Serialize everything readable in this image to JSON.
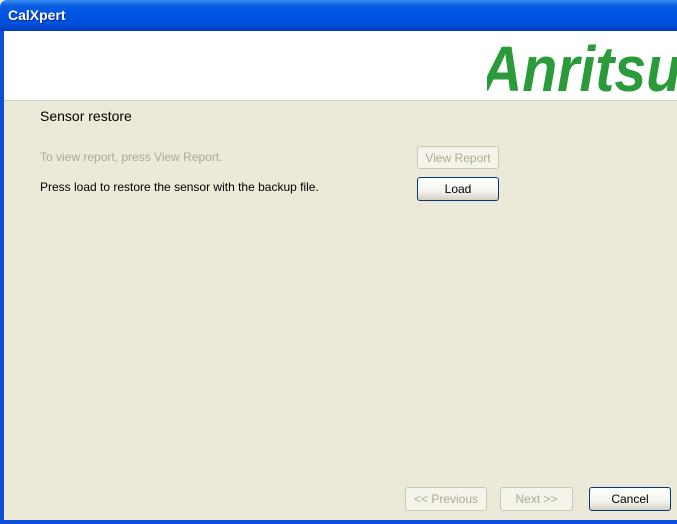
{
  "window": {
    "title": "CalXpert"
  },
  "banner": {
    "logo_text": "Anritsu",
    "brand_color": "#2b9a3a"
  },
  "page": {
    "heading": "Sensor restore",
    "report_instruction": "To view report, press View Report.",
    "load_instruction": "Press load to restore the sensor with the backup file."
  },
  "buttons": {
    "view_report": "View Report",
    "load": "Load",
    "previous": "<< Previous",
    "next": "Next >>",
    "cancel": "Cancel"
  }
}
